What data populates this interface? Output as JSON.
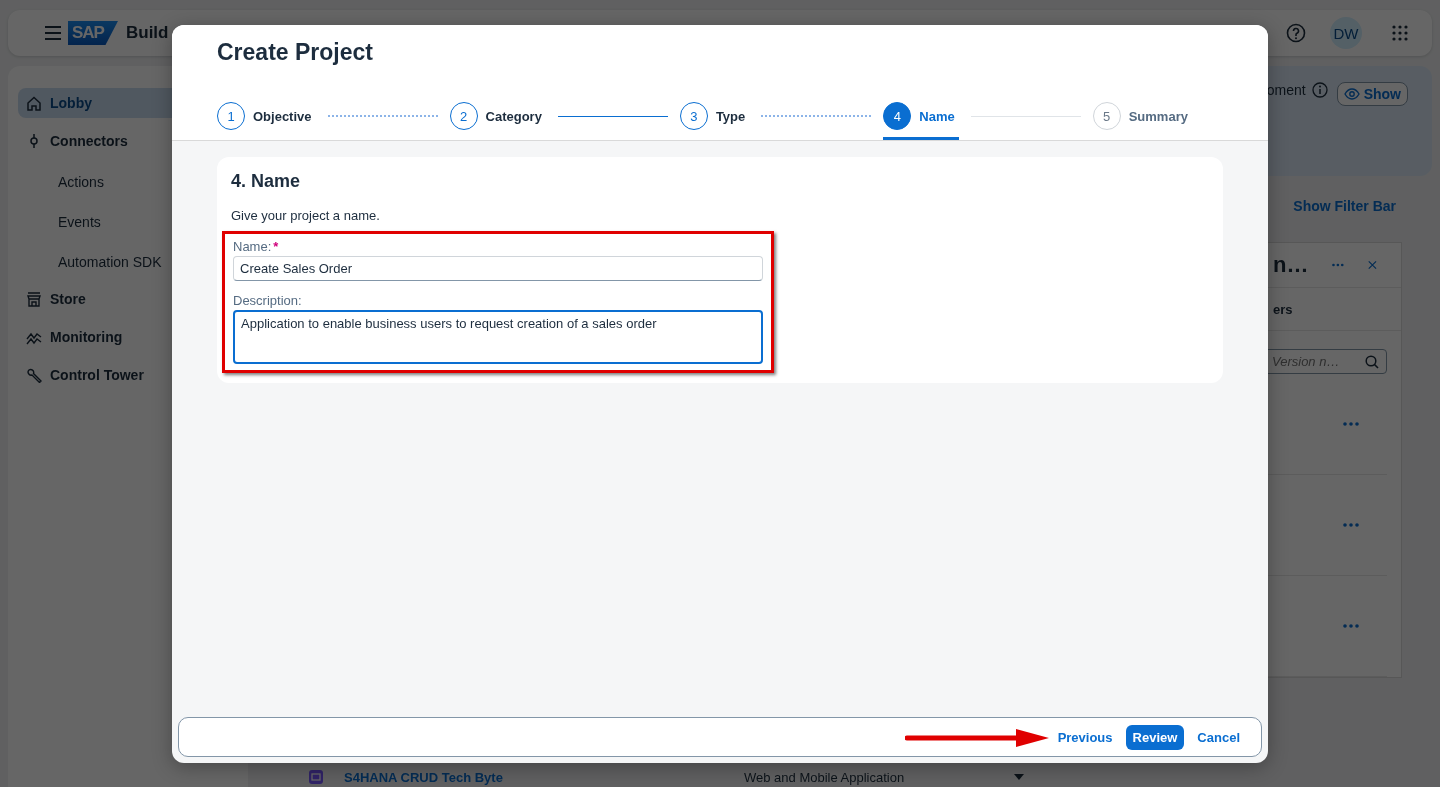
{
  "app": {
    "title": "Build",
    "logo": "SAP",
    "avatar": "DW",
    "sidebar": [
      {
        "label": "Lobby",
        "selected": true
      },
      {
        "label": "Connectors",
        "selected": false,
        "children": [
          {
            "label": "Actions"
          },
          {
            "label": "Events"
          },
          {
            "label": "Automation SDK"
          }
        ]
      },
      {
        "label": "Store",
        "selected": false
      },
      {
        "label": "Monitoring",
        "selected": false
      },
      {
        "label": "Control Tower",
        "selected": false
      }
    ],
    "banner": {
      "text": "oment",
      "button": "Show"
    },
    "filter_link": "Show Filter Bar",
    "panel": {
      "title": "n…",
      "tab": "ers",
      "search_placeholder": "Version n…"
    },
    "list_row": {
      "name": "S4HANA CRUD Tech Byte",
      "type": "Web and Mobile Application"
    }
  },
  "dialog": {
    "title": "Create Project",
    "steps": [
      {
        "number": "1",
        "label": "Objective",
        "selected": false,
        "enabled": true
      },
      {
        "number": "2",
        "label": "Category",
        "selected": false,
        "enabled": true
      },
      {
        "number": "3",
        "label": "Type",
        "selected": false,
        "enabled": true
      },
      {
        "number": "4",
        "label": "Name",
        "selected": true,
        "enabled": true
      },
      {
        "number": "5",
        "label": "Summary",
        "selected": false,
        "enabled": false
      }
    ],
    "connectors": [
      {
        "kind": "dotted"
      },
      {
        "kind": "solid"
      },
      {
        "kind": "dotted"
      },
      {
        "kind": "plain"
      }
    ],
    "section": {
      "heading": "4. Name",
      "hint": "Give your project a name.",
      "fields": [
        {
          "kind": "input",
          "label": "Name:",
          "required_mark": "*",
          "value": "Create Sales Order",
          "focused": false
        },
        {
          "kind": "textarea",
          "label": "Description:",
          "value": "Application to enable business users to request creation of a sales order",
          "focused": true
        }
      ]
    },
    "footer": [
      {
        "label": "Previous",
        "emphasized": false
      },
      {
        "label": "Review",
        "emphasized": true
      },
      {
        "label": "Cancel",
        "emphasized": false
      }
    ]
  }
}
